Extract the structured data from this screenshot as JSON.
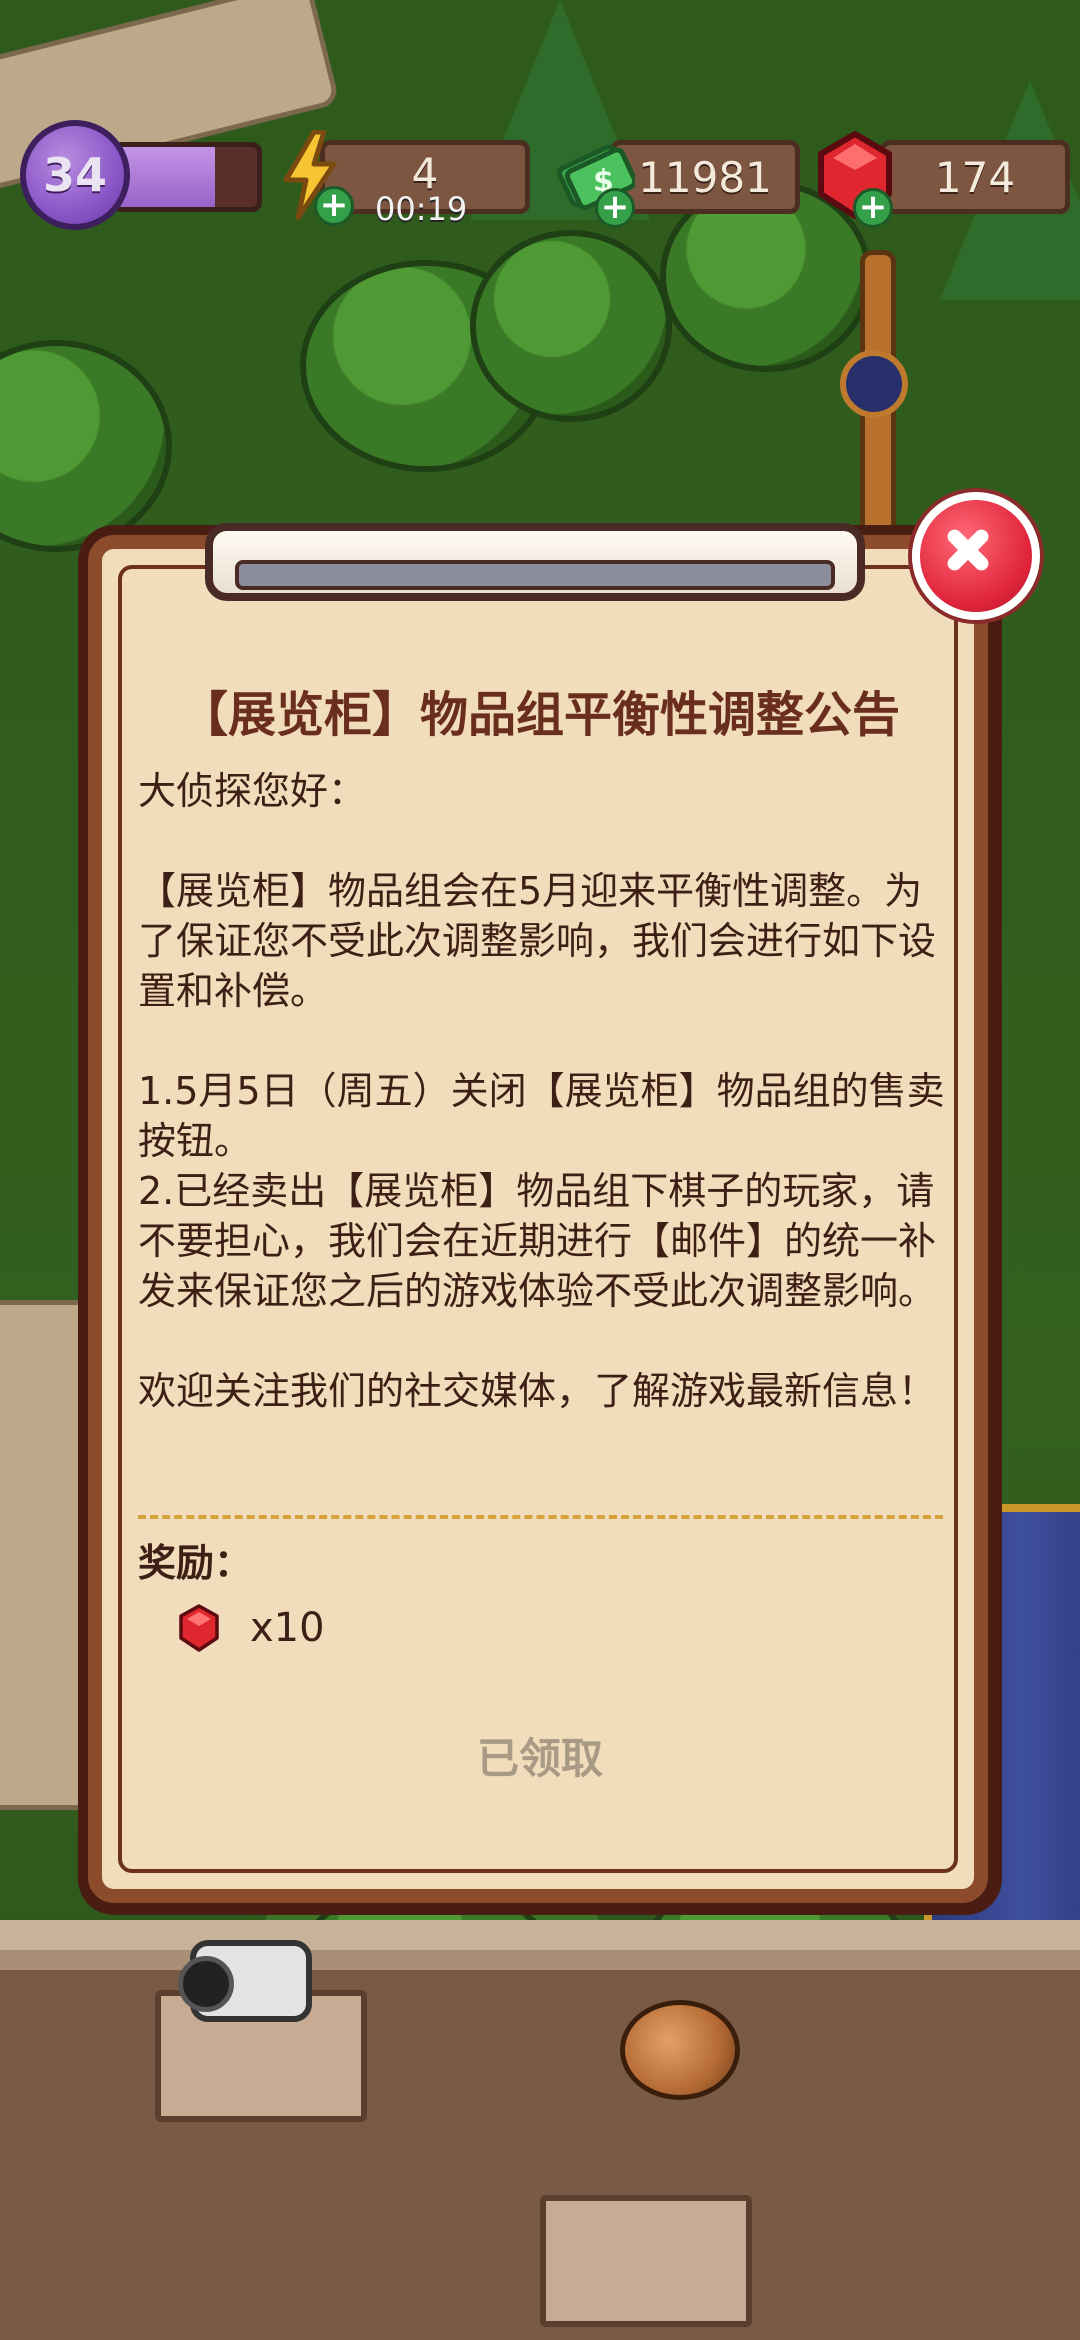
{
  "hud": {
    "level": "34",
    "xp_progress": 0.7,
    "energy": "4",
    "energy_timer": "00:19",
    "cash": "11981",
    "gems": "174",
    "icons": [
      "lightning-icon",
      "cash-stack-icon",
      "red-gem-icon",
      "plus-icon"
    ]
  },
  "notice": {
    "title": "【展览柜】物品组平衡性调整公告",
    "greeting": "大侦探您好：",
    "paragraph1": "【展览柜】物品组会在5月迎来平衡性调整。为了保证您不受此次调整影响，我们会进行如下设置和补偿。",
    "item1": "1.5月5日（周五）关闭【展览柜】物品组的售卖按钮。",
    "item2": "2.已经卖出【展览柜】物品组下棋子的玩家，请不要担心，我们会在近期进行【邮件】的统一补发来保证您之后的游戏体验不受此次调整影响。",
    "closing": "欢迎关注我们的社交媒体，了解游戏最新信息！",
    "reward_label": "奖励：",
    "reward_quantity": "x10",
    "claimed_label": "已领取",
    "close_icon": "close-icon"
  },
  "colors": {
    "panel_bg": "#f1dcbb",
    "panel_border": "#8c4c2c",
    "title_text": "#6a2f1c",
    "divider": "#d6a23a",
    "close_button": "#e0253b"
  }
}
